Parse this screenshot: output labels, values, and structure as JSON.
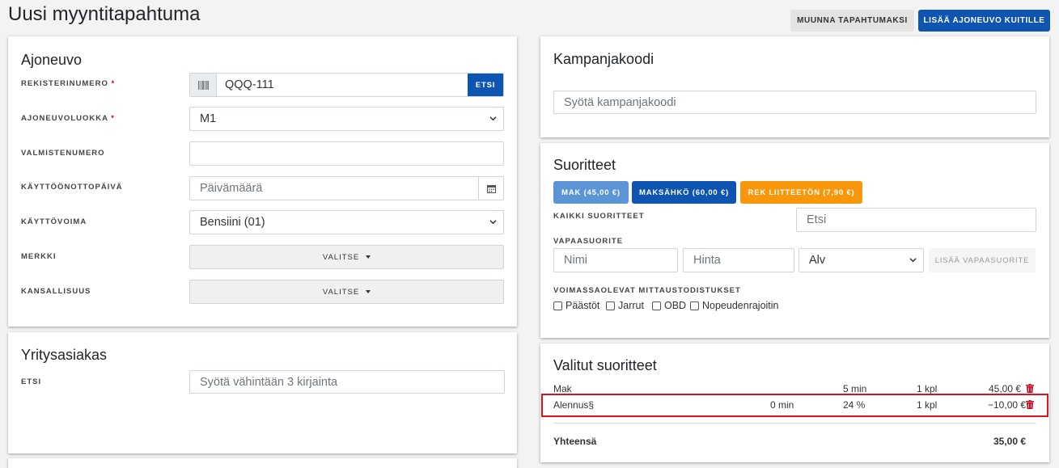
{
  "page": {
    "title": "Uusi myyntitapahtuma"
  },
  "toolbar": {
    "convert_label": "MUUNNA TAPAHTUMAKSI",
    "add_vehicle_label": "LISÄÄ AJONEUVO KUITILLE"
  },
  "vehicle": {
    "title": "Ajoneuvo",
    "reg_label": "REKISTERINUMERO",
    "reg_value": "QQQ-111",
    "search_label": "ETSI",
    "class_label": "AJONEUVOLUOKKA",
    "class_value": "M1",
    "serial_label": "VALMISTENUMERO",
    "serial_value": "",
    "date_label": "KÄYTTÖÖNOTTOPÄIVÄ",
    "date_placeholder": "Päivämäärä",
    "fuel_label": "KÄYTTÖVOIMA",
    "fuel_value": "Bensiini (01)",
    "brand_label": "MERKKI",
    "brand_button": "VALITSE",
    "nationality_label": "KANSALLISUUS",
    "nationality_button": "VALITSE",
    "required_mark": "*"
  },
  "company": {
    "title": "Yritysasiakas",
    "search_label": "ETSI",
    "search_placeholder": "Syötä vähintään 3 kirjainta"
  },
  "campaign": {
    "title": "Kampanjakoodi",
    "placeholder": "Syötä kampanjakoodi"
  },
  "services": {
    "title": "Suoritteet",
    "chips": [
      {
        "label": "MAK (45,00 €)",
        "color": "#5b95d5"
      },
      {
        "label": "MAKSÄHKÖ (60,00 €)",
        "color": "#0d55b1"
      },
      {
        "label": "REK LIITTEETÖN (7,90 €)",
        "color": "#f8960c"
      }
    ],
    "all_label": "KAIKKI SUORITTEET",
    "all_placeholder": "Etsi",
    "free_label": "VAPAASUORITE",
    "name_placeholder": "Nimi",
    "price_placeholder": "Hinta",
    "vat_value": "Alv",
    "add_free_label": "LISÄÄ VAPAASUORITE",
    "certs_label": "VOIMASSAOLEVAT MITTAUSTODISTUKSET",
    "certs": [
      "Päästöt",
      "Jarrut",
      "OBD",
      "Nopeudenrajoitin"
    ]
  },
  "selected": {
    "title": "Valitut suoritteet",
    "rows": [
      {
        "name": "Mak",
        "time2": "",
        "time": "5 min",
        "qty": "1 kpl",
        "price": "45,00 €"
      },
      {
        "name": "Alennus§",
        "time2": "0 min",
        "time": "24 %",
        "qty": "1 kpl",
        "price": "−10,00 €"
      }
    ],
    "total_label": "Yhteensä",
    "total_value": "35,00 €"
  },
  "colors": {
    "primary": "#0d55b1",
    "highlight": "#e0131d",
    "trash": "#d0021b"
  }
}
